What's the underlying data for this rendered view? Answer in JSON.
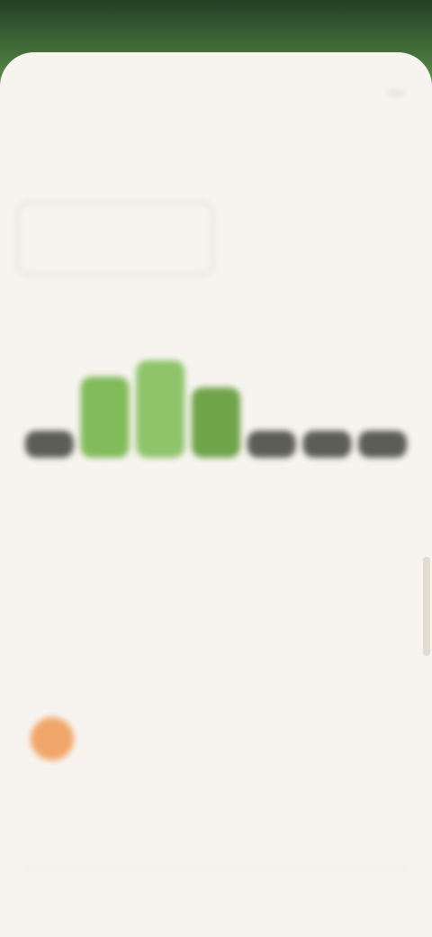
{
  "screen": {
    "title": "",
    "section_heading": "",
    "card_selected": {
      "label": "",
      "value": ""
    },
    "card_other": {
      "label": "",
      "value": ""
    },
    "description": "",
    "insights_heading": "",
    "insight": {
      "title": "",
      "body": "",
      "meta": "",
      "link": ""
    },
    "footer_note": ""
  },
  "chart_data": {
    "type": "bar",
    "categories": [
      "",
      "",
      "",
      "",
      "",
      "",
      ""
    ],
    "values": [
      1,
      3,
      3.6,
      2.6,
      1,
      1,
      1
    ],
    "ylim": [
      0,
      4
    ],
    "colors": [
      "#5c5e56",
      "#82bb5a",
      "#8ec46a",
      "#6fa44a",
      "#5c5e56",
      "#5c5e56",
      "#5c5e56"
    ],
    "grid": false
  },
  "colors": {
    "background": "#f7f4ef",
    "accent_green": "#82bb5a",
    "neutral_bar": "#5c5e56",
    "avatar": "#f0a66a"
  }
}
